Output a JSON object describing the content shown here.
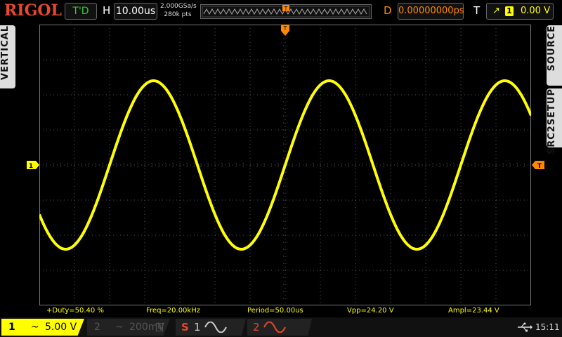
{
  "brand": "RIGOL",
  "header": {
    "run_status": "T'D",
    "horizontal_label": "H",
    "timebase": "10.00us",
    "sample_rate": "2.000GSa/s",
    "memory_depth": "280k pts",
    "delay_label": "D",
    "delay_value": "0.00000000ps",
    "trigger_label": "T",
    "trigger_source": "1",
    "trigger_level": "0.00 V"
  },
  "side_tabs": {
    "left": "VERTICAL",
    "right_top": "SOURCE",
    "right_bottom": "SRC2SETUP"
  },
  "markers": {
    "channel1_ground": "1",
    "trigger_level": "T",
    "trigger_position": "T"
  },
  "measurements": [
    {
      "text": "+Duty=50.40 %"
    },
    {
      "text": "Freq=20.00kHz"
    },
    {
      "text": "Period=50.00us"
    },
    {
      "text": "Vpp=24.20 V"
    },
    {
      "text": "Ampl=23.44 V"
    }
  ],
  "channels": [
    {
      "number": "1",
      "coupling": "~",
      "scale": "5.00 V",
      "active": true
    },
    {
      "number": "2",
      "coupling": "~",
      "scale": "200mV",
      "active": false
    }
  ],
  "sources": {
    "s_label": "S",
    "source1": "1",
    "source2": "2"
  },
  "clock": "15:11",
  "colors": {
    "ch1": "#ffff00",
    "brand": "#e8482f",
    "trigger": "#ff8800",
    "run_status": "#33cc33"
  },
  "waveform": {
    "type": "sine",
    "peak_div": 2.4,
    "period_div": 5,
    "phase_note_div_at_left": 0
  }
}
